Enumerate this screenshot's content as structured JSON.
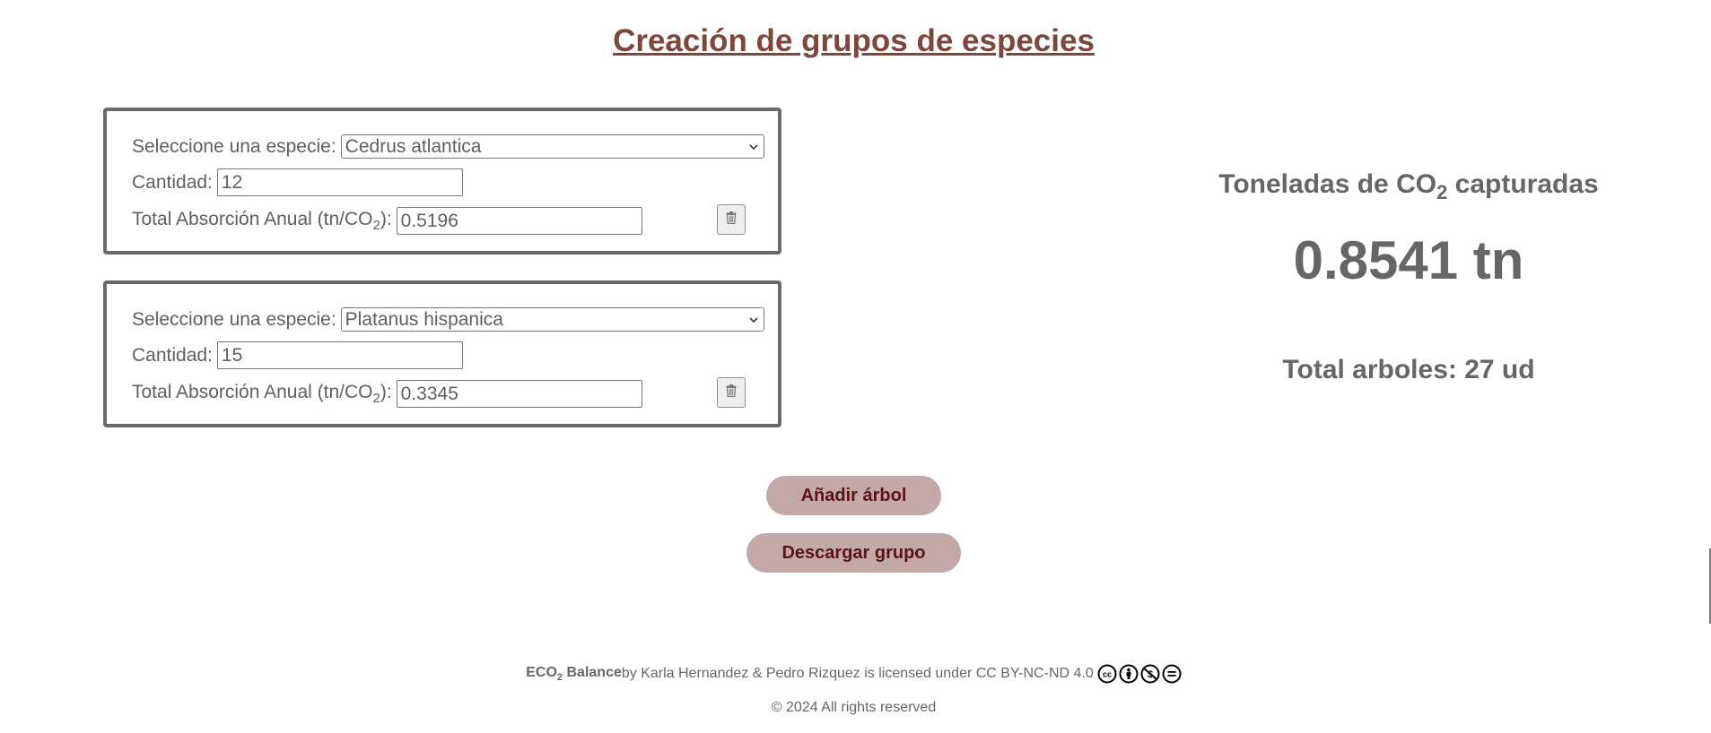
{
  "title": "Creación de grupos de especies",
  "labels": {
    "species": "Seleccione una especie:",
    "quantity": "Cantidad:",
    "absorption_prefix": "Total Absorción Anual (tn/CO",
    "absorption_sub": "2",
    "absorption_suffix": "):"
  },
  "groups": [
    {
      "species": "Cedrus atlantica",
      "quantity": "12",
      "absorption": "0.5196"
    },
    {
      "species": "Platanus hispanica",
      "quantity": "15",
      "absorption": "0.3345"
    }
  ],
  "summary": {
    "title_prefix": "Toneladas de CO",
    "title_sub": "2",
    "title_suffix": " capturadas",
    "value": "0.8541 tn",
    "trees": "Total arboles: 27 ud"
  },
  "buttons": {
    "add": "Añadir árbol",
    "download": "Descargar grupo"
  },
  "footer": {
    "brand_prefix": "ECO",
    "brand_sub": "2",
    "brand_suffix": " Balance",
    "text": " by Karla Hernandez & Pedro Rizquez is licensed under CC BY-NC-ND 4.0",
    "copyright": "© 2024 All rights reserved"
  },
  "icons": [
    "chevron-down-icon",
    "trash-icon",
    "cc-icon",
    "by-icon",
    "nc-icon",
    "nd-icon"
  ],
  "colors": {
    "title": "#7d473b",
    "button_bg": "#c2a9a7",
    "button_text": "#5c1313",
    "text": "#5f5f5f"
  }
}
